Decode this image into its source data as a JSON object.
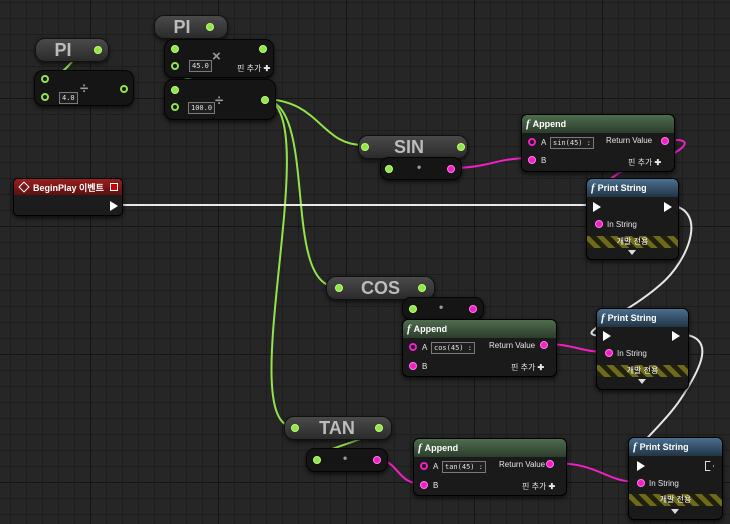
{
  "colors": {
    "float_wire": "#93e34b",
    "string_wire": "#f21fc6",
    "exec_wire": "#e8e8e8",
    "graph_background": "#262626"
  },
  "variables": {
    "pi_1": "PI",
    "pi_2": "PI",
    "sin": "SIN",
    "cos": "COS",
    "tan": "TAN"
  },
  "operators": {
    "divide_1": {
      "symbol": "÷",
      "input_value": "4.0"
    },
    "multiply": {
      "symbol": "×",
      "input_value": "45.0",
      "add_pin": "핀 추가",
      "add_icon": "plus-icon"
    },
    "divide_2": {
      "symbol": "÷",
      "input_value": "100.0"
    },
    "dot_sin": "•",
    "dot_cos": "•",
    "dot_tan": "•"
  },
  "event": {
    "title": "BeginPlay 이벤트",
    "icon": "event-diamond-icon"
  },
  "append_nodes": [
    {
      "title": "Append",
      "a_label": "A",
      "a_value": "sin(45) :",
      "b_label": "B",
      "return_label": "Return Value",
      "add_pin": "핀 추가"
    },
    {
      "title": "Append",
      "a_label": "A",
      "a_value": "cos(45) :",
      "b_label": "B",
      "return_label": "Return Value",
      "add_pin": "핀 추가"
    },
    {
      "title": "Append",
      "a_label": "A",
      "a_value": "tan(45) :",
      "b_label": "B",
      "return_label": "Return Value",
      "add_pin": "핀 추가"
    }
  ],
  "print_nodes": [
    {
      "title": "Print String",
      "in_label": "In String",
      "dev_only": "개발 전용"
    },
    {
      "title": "Print String",
      "in_label": "In String",
      "dev_only": "개발 전용"
    },
    {
      "title": "Print String",
      "in_label": "In String",
      "dev_only": "개발 전용"
    }
  ],
  "function_icon": "f"
}
